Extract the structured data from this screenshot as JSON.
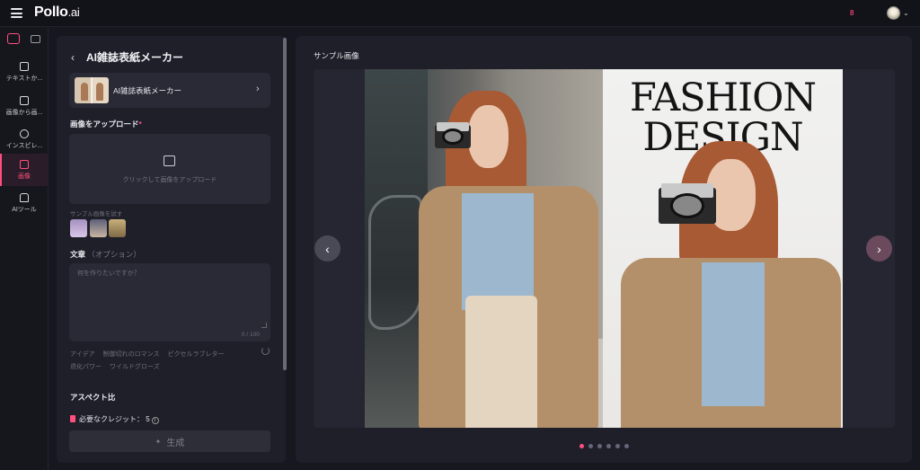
{
  "app": {
    "logo_main": "Pollo",
    "logo_suffix": ".ai",
    "top_badge": "8"
  },
  "sidebar": {
    "items": [
      {
        "label": "テキストか..."
      },
      {
        "label": "画像から画..."
      },
      {
        "label": "インスピレ..."
      },
      {
        "label": "画像"
      },
      {
        "label": "AIツール"
      }
    ]
  },
  "panel": {
    "back_icon": "chevron-left-icon",
    "title": "AI雑誌表紙メーカー",
    "tool_name": "AI雑誌表紙メーカー",
    "upload_label": "画像をアップロード",
    "upload_required": "*",
    "upload_hint": "クリックして画像をアップロード",
    "sample_label": "サンプル画像を試す",
    "text_label": "文章",
    "text_optional": "（オプション）",
    "text_placeholder": "何を作りたいですか？",
    "text_count": "0 / 100",
    "ideas": [
      "アイデア",
      "制御切れのロマンス",
      "ピクセルラブレター",
      "退化パワー",
      "ワイルドグローズ"
    ],
    "aspect_label": "アスペクト比",
    "credits_text": "必要なクレジット：",
    "credits_value": "5",
    "generate_label": "生成"
  },
  "preview": {
    "title": "サンプル画像",
    "magazine_title_line1": "FASHION",
    "magazine_title_line2": "DESIGN",
    "active_slide": 1,
    "slide_count": 6
  },
  "colors": {
    "accent": "#ff4f7e",
    "panel_bg": "#1f1f29",
    "page_bg": "#17171f"
  }
}
